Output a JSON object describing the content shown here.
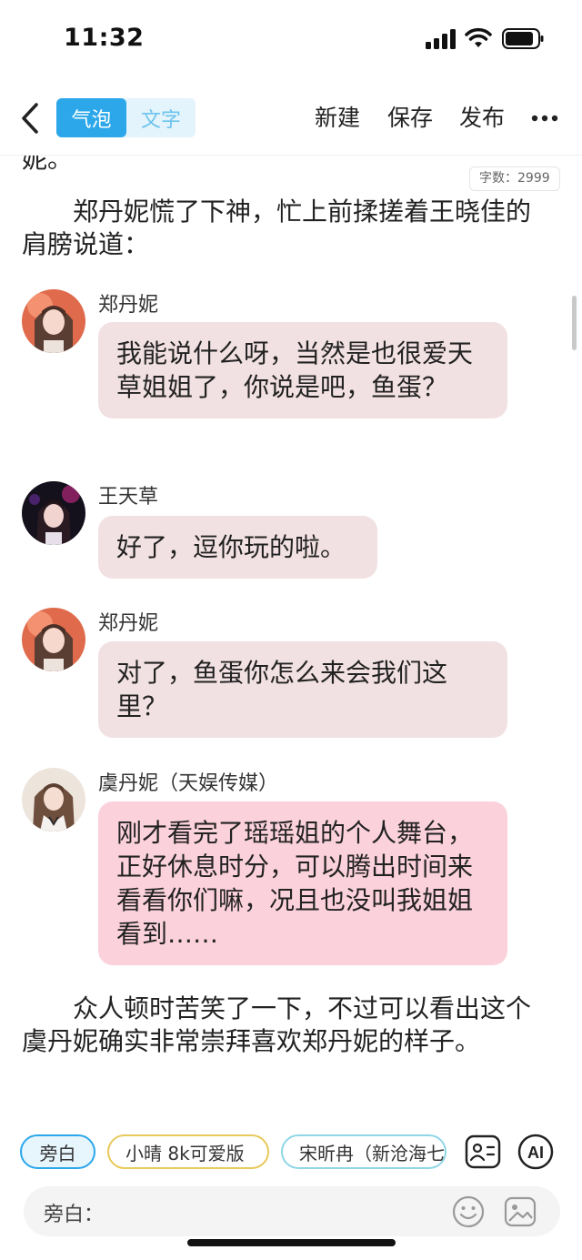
{
  "status_bar": {
    "time": "11:32"
  },
  "nav": {
    "mode_bubble": "气泡",
    "mode_text": "文字",
    "new_label": "新建",
    "save_label": "保存",
    "publish_label": "发布"
  },
  "content": {
    "word_count": "字数：2999",
    "cut_paragraph": "妮。",
    "paragraph_1": "　　郑丹妮慌了下神，忙上前揉搓着王晓佳的肩膀说道：",
    "messages": [
      {
        "speaker": "郑丹妮",
        "text": "我能说什么呀，当然是也很爱天草姐姐了，你说是吧，鱼蛋？"
      },
      {
        "speaker": "王天草",
        "text": "好了，逗你玩的啦。"
      },
      {
        "speaker": "郑丹妮",
        "text": "对了，鱼蛋你怎么来会我们这里？"
      },
      {
        "speaker": "虞丹妮（天娱传媒）",
        "text": "刚才看完了瑶瑶姐的个人舞台，正好休息时分，可以腾出时间来看看你们嘛，况且也没叫我姐姐看到……"
      }
    ],
    "paragraph_2": "　　众人顿时苦笑了一下，不过可以看出这个虞丹妮确实非常崇拜喜欢郑丹妮的样子。"
  },
  "bottom": {
    "chips": [
      "旁白",
      "小晴 8k可爱版",
      "宋昕冉（新沧海七"
    ],
    "input_label": "旁白："
  },
  "colors": {
    "accent_blue": "#2ba7ea",
    "bubble_default": "#f2e1e3",
    "bubble_highlight": "#fbd1dc"
  }
}
